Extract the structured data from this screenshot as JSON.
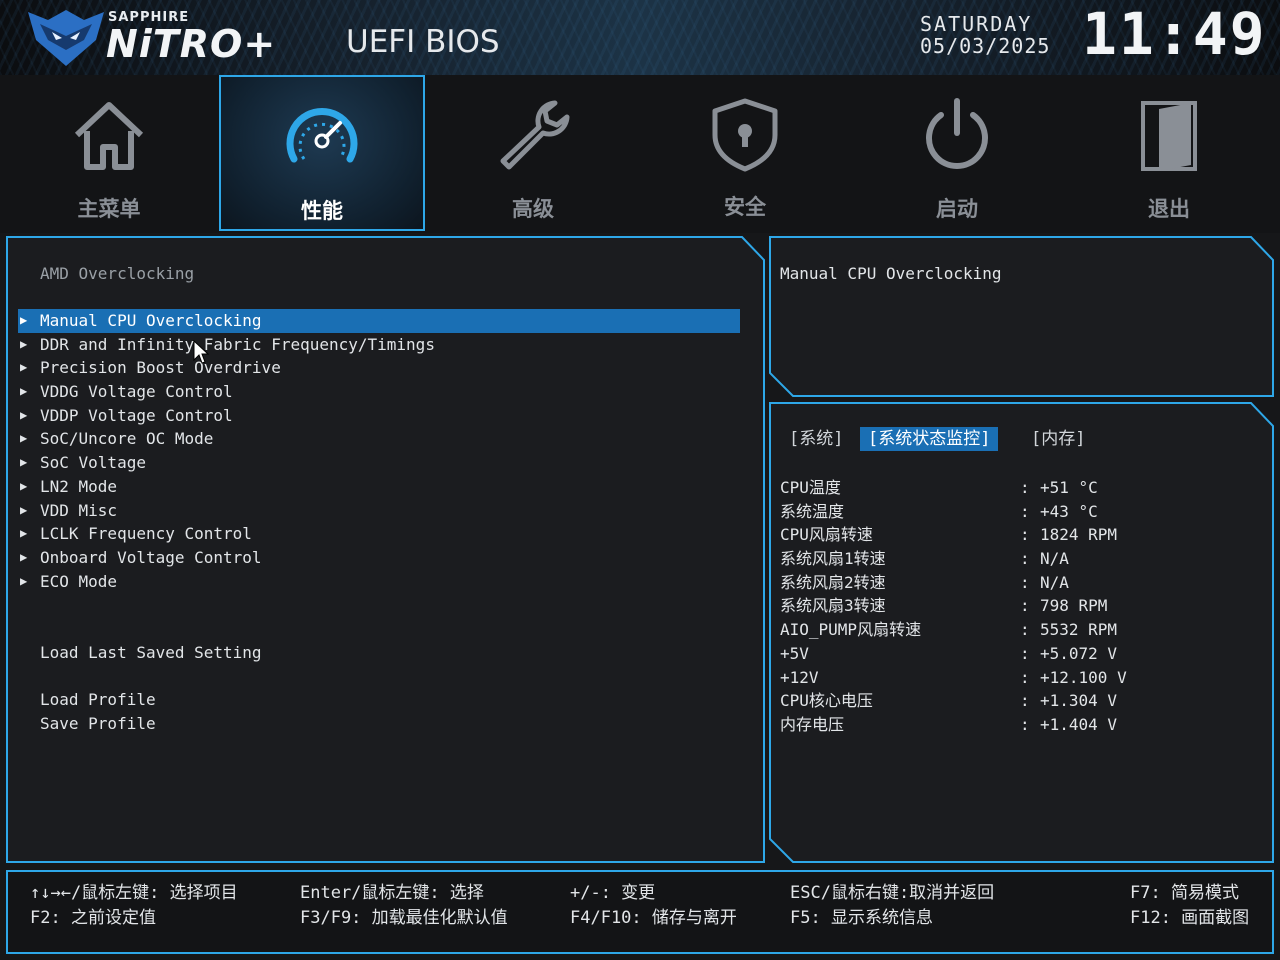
{
  "header": {
    "brand_small": "SAPPHIRE",
    "brand_big": "NiTRO+",
    "bios_title": "UEFI BIOS",
    "weekday": "SATURDAY",
    "date": "05/03/2025",
    "time": "11:49"
  },
  "nav": {
    "items": [
      {
        "label": "主菜单",
        "icon": "home-icon"
      },
      {
        "label": "性能",
        "icon": "speedometer-icon",
        "active": true
      },
      {
        "label": "高级",
        "icon": "wrench-icon"
      },
      {
        "label": "安全",
        "icon": "shield-lock-icon"
      },
      {
        "label": "启动",
        "icon": "power-icon"
      },
      {
        "label": "退出",
        "icon": "exit-door-icon"
      }
    ]
  },
  "main": {
    "section_title": "AMD Overclocking",
    "menu": [
      "Manual CPU Overclocking",
      "DDR and Infinity Fabric Frequency/Timings",
      "Precision Boost Overdrive",
      "VDDG Voltage Control",
      "VDDP Voltage Control",
      "SoC/Uncore OC Mode",
      "SoC Voltage",
      "LN2 Mode",
      "VDD Misc",
      "LCLK Frequency Control",
      "Onboard Voltage Control",
      "ECO Mode"
    ],
    "load_last": "Load Last Saved Setting",
    "load_profile": "Load Profile",
    "save_profile": "Save Profile"
  },
  "help": {
    "text": "Manual CPU Overclocking"
  },
  "monitor": {
    "tabs": [
      "[系统]",
      "[系统状态监控]",
      "[内存]"
    ],
    "rows": [
      {
        "k": "CPU温度",
        "v": "+51 °C"
      },
      {
        "k": "系统温度",
        "v": "+43 °C"
      },
      {
        "k": "CPU风扇转速",
        "v": "1824 RPM"
      },
      {
        "k": "系统风扇1转速",
        "v": "N/A"
      },
      {
        "k": "系统风扇2转速",
        "v": "N/A"
      },
      {
        "k": "系统风扇3转速",
        "v": "798 RPM"
      },
      {
        "k": "AIO_PUMP风扇转速",
        "v": "5532 RPM"
      },
      {
        "k": "+5V",
        "v": "+5.072 V"
      },
      {
        "k": "+12V",
        "v": "+12.100 V"
      },
      {
        "k": "CPU核心电压",
        "v": "+1.304 V"
      },
      {
        "k": "内存电压",
        "v": "+1.404 V"
      }
    ]
  },
  "footer": {
    "keys": [
      "↑↓→←/鼠标左键: 选择项目",
      "F2: 之前设定值",
      "Enter/鼠标左键: 选择",
      "F3/F9: 加载最佳化默认值",
      "+/-: 变更",
      "F4/F10: 储存与离开",
      "ESC/鼠标右键:取消并返回",
      "F5: 显示系统信息",
      "F7: 简易模式",
      "F12: 画面截图"
    ]
  },
  "colors": {
    "accent": "#2ea7e8",
    "selection": "#1a6fb4"
  }
}
